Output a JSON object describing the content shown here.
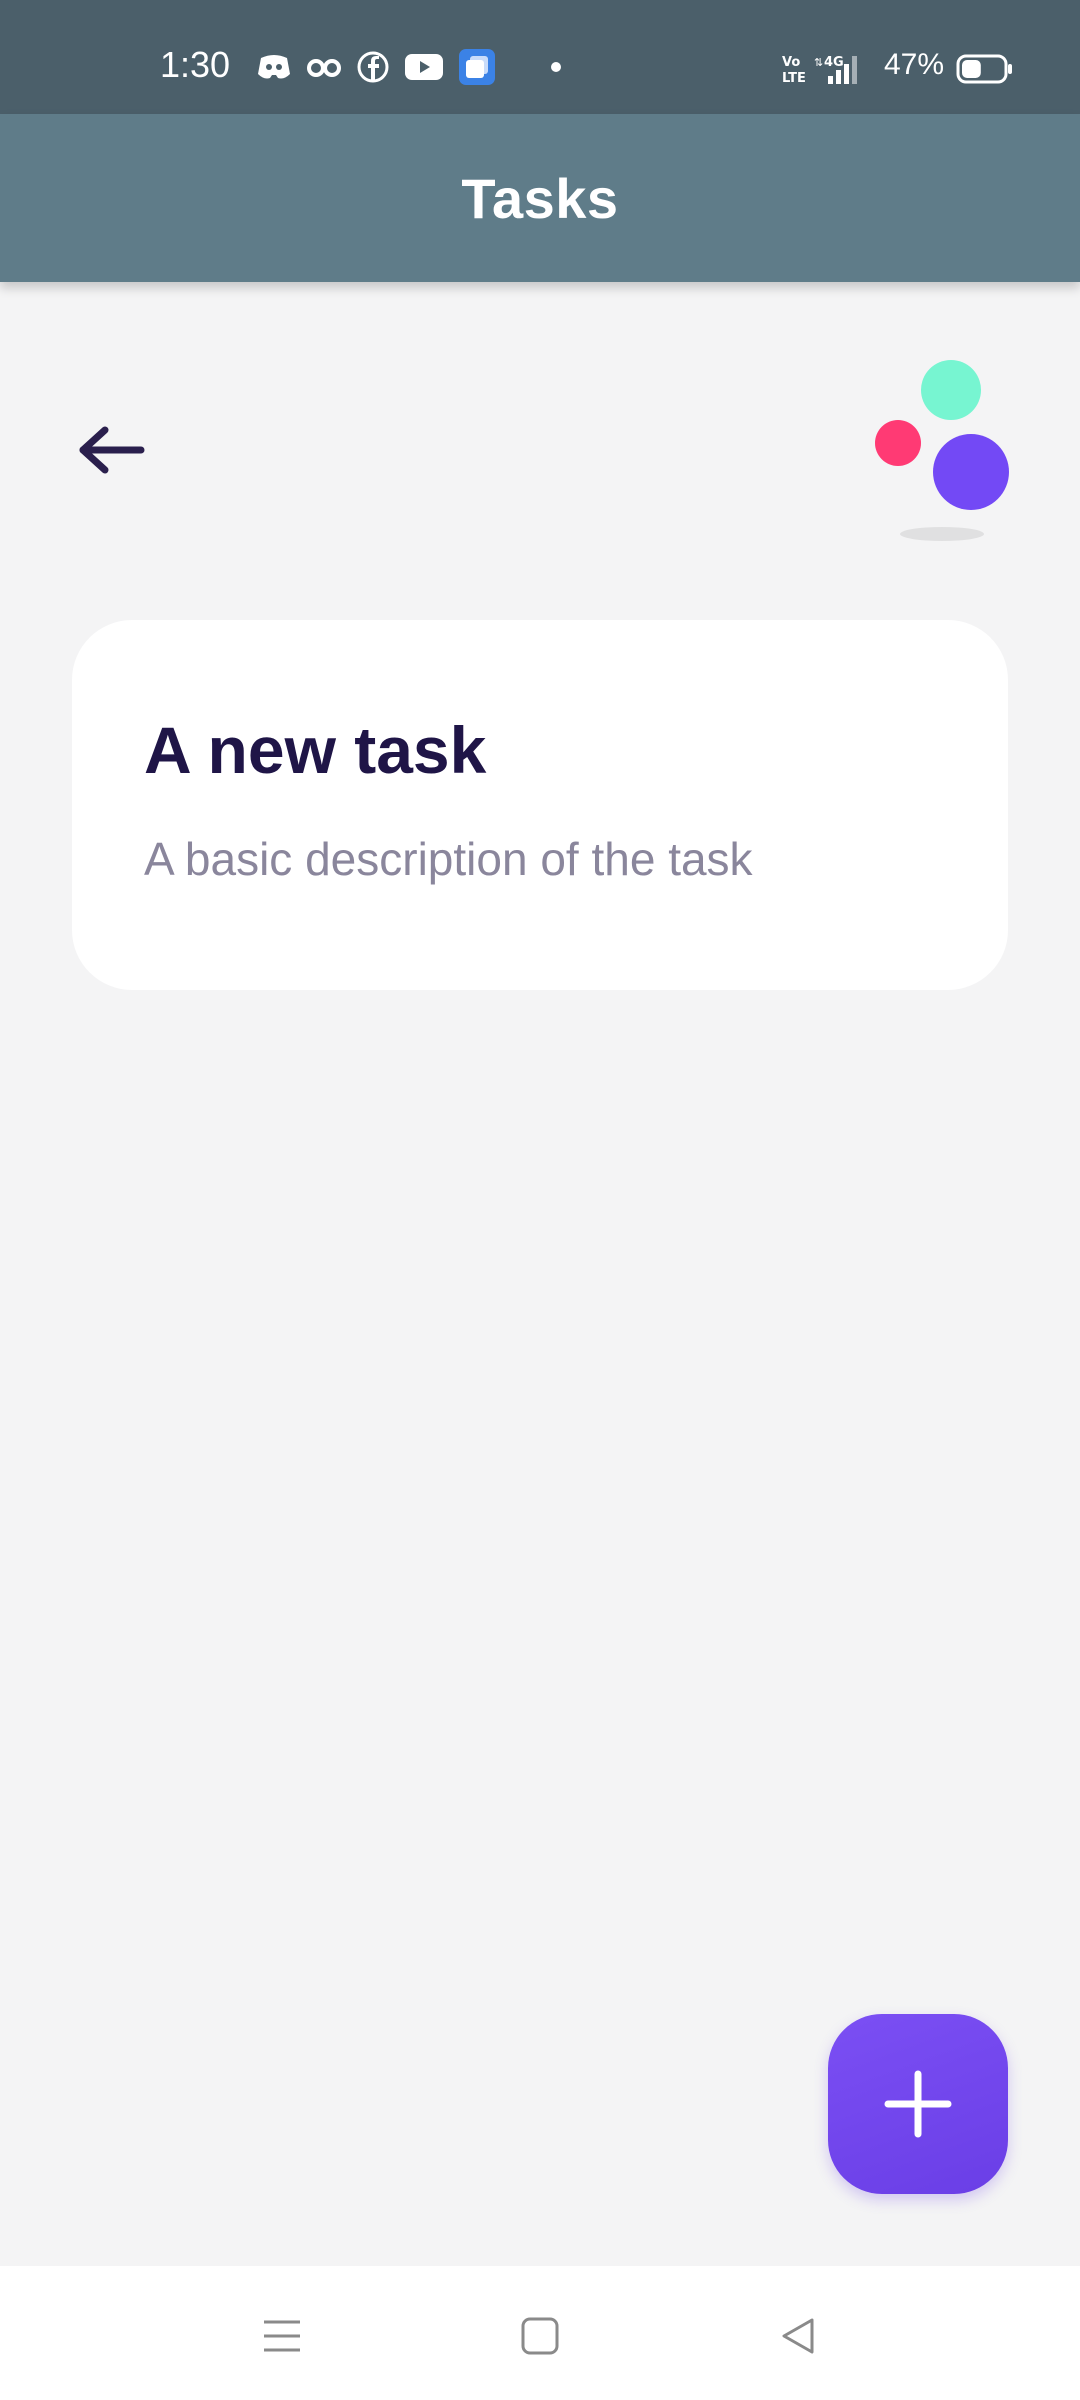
{
  "status_bar": {
    "time": "1:30",
    "battery_percent": "47%",
    "battery_level": 0.47,
    "network": "4G",
    "icons": [
      "discord-icon",
      "glasses-icon",
      "facebook-icon",
      "youtube-icon",
      "multitask-icon",
      "dot-icon",
      "volte-icon",
      "signal-icon",
      "battery-icon"
    ]
  },
  "app_bar": {
    "title": "Tasks"
  },
  "header": {
    "back_icon": "arrow-left-icon",
    "logo_icon": "bubbles-logo-icon"
  },
  "tasks": [
    {
      "title": "A new task",
      "description": "A basic description of the task"
    }
  ],
  "fab": {
    "icon": "plus-icon"
  },
  "nav_bar": {
    "icons": [
      "menu-icon",
      "home-icon",
      "back-triangle-icon"
    ]
  },
  "colors": {
    "status_bar": "#4b5f6a",
    "app_bar": "#5f7c89",
    "background": "#f4f4f5",
    "title_text": "#1f1547",
    "description_text": "#8a869c",
    "accent": "#6a3ee6",
    "logo_mint": "#77f5d1",
    "logo_pink": "#ff3a74",
    "logo_purple": "#7349f5"
  }
}
